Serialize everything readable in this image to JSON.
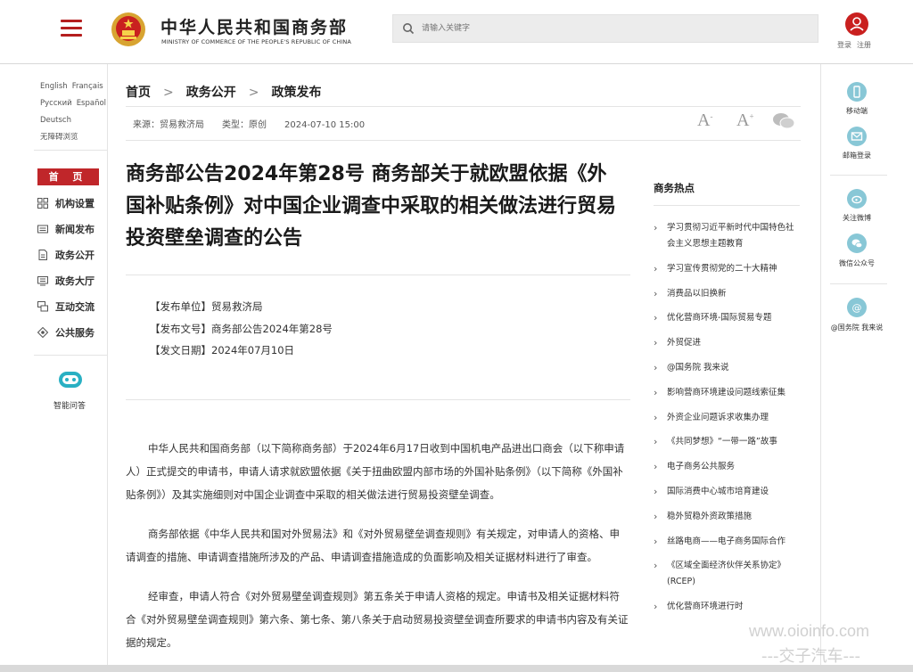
{
  "header": {
    "brand_cn": "中华人民共和国商务部",
    "brand_en": "MINISTRY OF COMMERCE OF THE PEOPLE'S REPUBLIC OF CHINA",
    "search_placeholder": "请输入关键字",
    "login": "登录",
    "register": "注册",
    "accent_color": "#c0262a"
  },
  "left_sidebar": {
    "languages": [
      "English",
      "Français",
      "Русский",
      "Español",
      "Deutsch",
      "无障碍浏览"
    ],
    "home": "首 页",
    "nav": [
      {
        "label": "机构设置",
        "icon": "org-icon"
      },
      {
        "label": "新闻发布",
        "icon": "news-icon"
      },
      {
        "label": "政务公开",
        "icon": "document-icon"
      },
      {
        "label": "政务大厅",
        "icon": "hall-icon"
      },
      {
        "label": "互动交流",
        "icon": "chat-icon"
      },
      {
        "label": "公共服务",
        "icon": "service-icon"
      }
    ],
    "qa": "智能问答"
  },
  "breadcrumb": [
    "首页",
    "政务公开",
    "政策发布"
  ],
  "meta": {
    "source": "来源：贸易救济局",
    "type": "类型：原创",
    "datetime": "2024-07-10 15:00"
  },
  "article": {
    "title": "商务部公告2024年第28号 商务部关于就欧盟依据《外国补贴条例》对中国企业调查中采取的相关做法进行贸易投资壁垒调查的公告",
    "info": [
      "【发布单位】贸易救济局",
      "【发布文号】商务部公告2024年第28号",
      "【发文日期】2024年07月10日"
    ],
    "paragraphs": [
      "中华人民共和国商务部（以下简称商务部）于2024年6月17日收到中国机电产品进出口商会（以下称申请人）正式提交的申请书，申请人请求就欧盟依据《关于扭曲欧盟内部市场的外国补贴条例》（以下简称《外国补贴条例》）及其实施细则对中国企业调查中采取的相关做法进行贸易投资壁垒调查。",
      "商务部依据《中华人民共和国对外贸易法》和《对外贸易壁垒调查规则》有关规定，对申请人的资格、申请调查的措施、申请调查措施所涉及的产品、申请调查措施造成的负面影响及相关证据材料进行了审查。",
      "经审查，申请人符合《对外贸易壁垒调查规则》第五条关于申请人资格的规定。申请书及相关证据材料符合《对外贸易壁垒调查规则》第六条、第七条、第八条关于启动贸易投资壁垒调查所要求的申请书内容及有关证据的规定。"
    ]
  },
  "hot": {
    "title": "商务热点",
    "items": [
      "学习贯彻习近平新时代中国特色社会主义思想主题教育",
      "学习宣传贯彻党的二十大精神",
      "消费品以旧换新",
      "优化营商环境-国际贸易专题",
      "外贸促进",
      "@国务院 我来说",
      "影响营商环境建设问题线索征集",
      "外资企业问题诉求收集办理",
      "《共同梦想》“一带一路”故事",
      "电子商务公共服务",
      "国际消费中心城市培育建设",
      "稳外贸稳外资政策措施",
      "丝路电商——电子商务国际合作",
      "《区域全面经济伙伴关系协定》(RCEP)",
      "优化营商环境进行时"
    ]
  },
  "right_sidebar": {
    "items": [
      "移动端",
      "邮箱登录",
      "关注微博",
      "微信公众号",
      "@国务院 我来说"
    ]
  },
  "watermark": {
    "line1": "www.oioinfo.com",
    "line2": "---交子汽车---"
  }
}
